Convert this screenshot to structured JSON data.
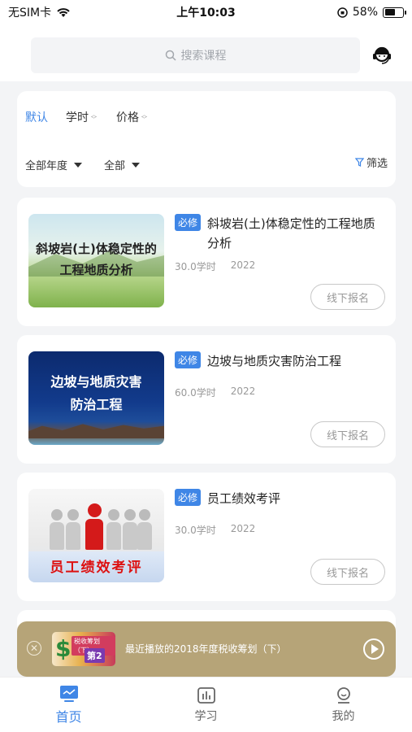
{
  "status_bar": {
    "carrier": "无SIM卡",
    "time": "上午10:03",
    "battery": "58%",
    "battery_level": 0.58
  },
  "search": {
    "placeholder": "搜索课程"
  },
  "filters": {
    "sort_default": "默认",
    "sort_hours": "学时",
    "sort_price": "价格",
    "year_dropdown": "全部年度",
    "category_dropdown": "全部",
    "screen_label": "筛选"
  },
  "courses": [
    {
      "badge": "必修",
      "title": "斜坡岩(土)体稳定性的工程地质分析",
      "hours": "30.0学时",
      "year": "2022",
      "action": "线下报名",
      "thumb_text_1": "斜坡岩(土)体稳定性的",
      "thumb_text_2": "工程地质分析"
    },
    {
      "badge": "必修",
      "title": "边坡与地质灾害防治工程",
      "hours": "60.0学时",
      "year": "2022",
      "action": "线下报名",
      "thumb_text_1": "边坡与地质灾害",
      "thumb_text_2": "防治工程"
    },
    {
      "badge": "必修",
      "title": "员工绩效考评",
      "hours": "30.0学时",
      "year": "2022",
      "action": "线下报名",
      "thumb_text_1": "员工绩效考评"
    }
  ],
  "player": {
    "title": "最近播放的2018年度税收筹划（下）",
    "thumb_label": "税收筹划（下）",
    "thumb_label2": "第2"
  },
  "tabbar": [
    {
      "label": "首页",
      "active": true
    },
    {
      "label": "学习",
      "active": false
    },
    {
      "label": "我的",
      "active": false
    }
  ],
  "colors": {
    "accent": "#3f86e6",
    "player_bg": "#b6a478"
  }
}
